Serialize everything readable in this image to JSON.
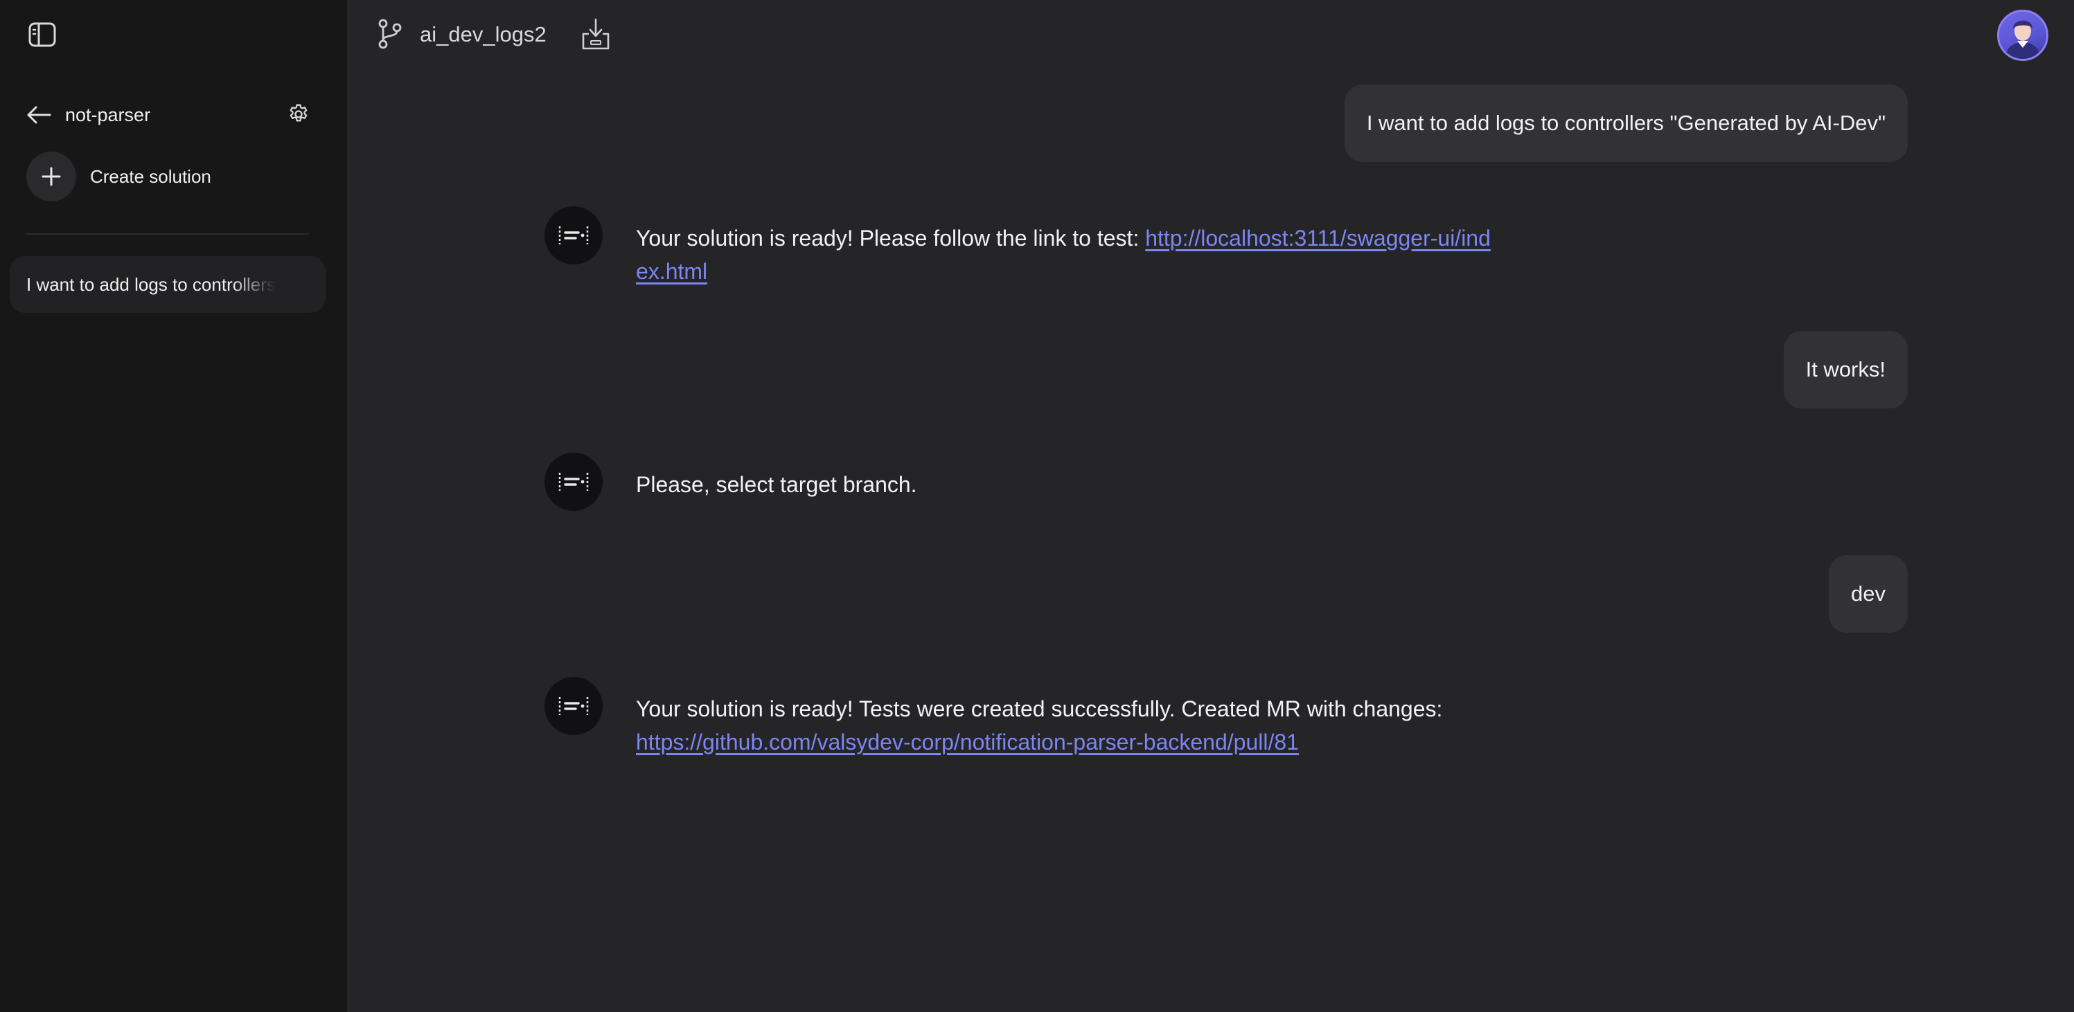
{
  "sidebar": {
    "project_name": "not-parser",
    "create_label": "Create solution",
    "sessions": [
      {
        "title": "I want to add logs to controllers"
      }
    ]
  },
  "topbar": {
    "branch": "ai_dev_logs2"
  },
  "messages": [
    {
      "role": "user",
      "text": "I want to add logs to controllers \"Generated by AI-Dev\""
    },
    {
      "role": "assistant",
      "text": "Your solution is ready! Please follow the link to test: ",
      "link": "http://localhost:3111/swagger-ui/index.html"
    },
    {
      "role": "user",
      "text": "It works!"
    },
    {
      "role": "assistant",
      "text": "Please, select target branch."
    },
    {
      "role": "user",
      "text": "dev"
    },
    {
      "role": "assistant",
      "text": "Your solution is ready! Tests were created successfully. Created MR with changes: ",
      "link": "https://github.com/valsydev-corp/notification-parser-backend/pull/81"
    }
  ],
  "icons": {
    "sidebar_toggle": "sidebar-toggle-icon",
    "back": "arrow-left-icon",
    "settings": "gear-icon",
    "create": "plus-icon",
    "branch": "git-branch-icon",
    "download": "download-icon",
    "assistant": "ai-dev-logo-icon"
  },
  "colors": {
    "background": "#252528",
    "sidebar": "#171717",
    "bubble": "#323236",
    "link": "#7b86f3",
    "avatar_accent": "#6f68e8"
  }
}
